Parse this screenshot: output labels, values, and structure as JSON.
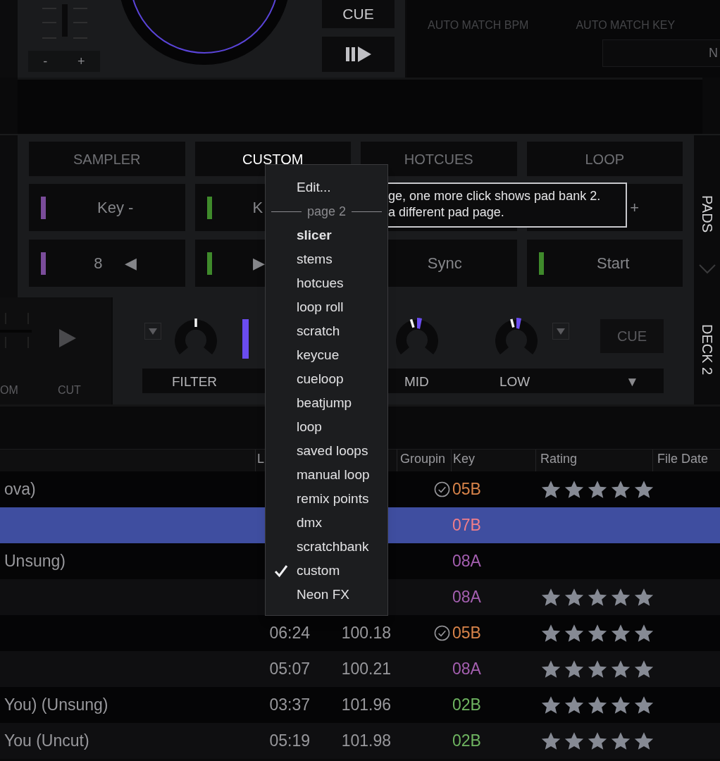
{
  "deck": {
    "minus": "-",
    "plus": "+",
    "cue": "CUE"
  },
  "match": {
    "bpm_label": "AUTO MATCH BPM",
    "key_label": "AUTO MATCH KEY",
    "key_field": "N"
  },
  "pad_tabs": [
    {
      "label": "SAMPLER",
      "selected": false
    },
    {
      "label": "CUSTOM",
      "selected": true
    },
    {
      "label": "HOTCUES",
      "selected": false
    },
    {
      "label": "LOOP",
      "selected": false
    }
  ],
  "pads": [
    {
      "kind": "center",
      "label": "Key -",
      "color": "#7a4c9a"
    },
    {
      "kind": "start",
      "label": "K",
      "color": "#3f8a2b"
    },
    {
      "kind": "blank"
    },
    {
      "kind": "end",
      "label": "+"
    },
    {
      "kind": "center",
      "label": "8",
      "icon": "◀",
      "color": "#7a4c9a"
    },
    {
      "kind": "start",
      "label": "▶",
      "color": "#3f8a2b"
    },
    {
      "kind": "center",
      "label": "Sync"
    },
    {
      "kind": "center",
      "label": "Start",
      "color": "#3f8a2b"
    }
  ],
  "pads_tab": "PADS",
  "left_strip": {
    "label_1": "OM",
    "label_2": "CUT"
  },
  "fx": {
    "filter": "FILTER",
    "mid": "MID",
    "low": "LOW",
    "cue": "CUE",
    "menu_arrow": "▼"
  },
  "deck_tab": "DECK 2",
  "table": {
    "columns": [
      "L",
      "Groupin",
      "Key",
      "Rating",
      "File Date"
    ],
    "rows": [
      {
        "title": "ova)",
        "analyzed": true,
        "key": "05B",
        "color": "#d9844a",
        "stars": 5,
        "selected": false
      },
      {
        "analyzed": false,
        "key": "07B",
        "color": "#f07e8a",
        "selected": true
      },
      {
        "title": "Unsung)",
        "analyzed": false,
        "key": "08A",
        "color": "#a45fb0",
        "selected": false
      },
      {
        "analyzed": false,
        "key": "08A",
        "color": "#a45fb0",
        "stars": 5,
        "selected": false
      },
      {
        "length": "06:24",
        "bpm": "100.18",
        "analyzed": true,
        "key": "05B",
        "color": "#d9844a",
        "stars": 5,
        "selected": false
      },
      {
        "length": "05:07",
        "bpm": "100.21",
        "analyzed": false,
        "key": "08A",
        "color": "#a45fb0",
        "stars": 5,
        "selected": false
      },
      {
        "title": "You) (Unsung)",
        "length": "03:37",
        "bpm": "101.96",
        "analyzed": false,
        "key": "02B",
        "color": "#6fb561",
        "stars": 5,
        "selected": false
      },
      {
        "title": "You (Uncut)",
        "length": "05:19",
        "bpm": "101.98",
        "analyzed": false,
        "key": "02B",
        "color": "#6fb561",
        "stars": 5,
        "selected": false
      }
    ]
  },
  "tooltip": {
    "lines": [
      "ge, one more click shows pad bank 2.",
      "a different pad page."
    ]
  },
  "menu": {
    "items": [
      {
        "kind": "item",
        "label": "Edit...",
        "checked": false
      },
      {
        "kind": "separator",
        "label": "page 2"
      },
      {
        "kind": "item",
        "label": "slicer",
        "bold": true,
        "checked": false
      },
      {
        "kind": "item",
        "label": "stems",
        "checked": false
      },
      {
        "kind": "item",
        "label": "hotcues",
        "checked": false
      },
      {
        "kind": "item",
        "label": "loop roll",
        "checked": false
      },
      {
        "kind": "item",
        "label": "scratch",
        "checked": false
      },
      {
        "kind": "item",
        "label": "keycue",
        "checked": false
      },
      {
        "kind": "item",
        "label": "cueloop",
        "checked": false
      },
      {
        "kind": "item",
        "label": "beatjump",
        "checked": false
      },
      {
        "kind": "item",
        "label": "loop",
        "checked": false
      },
      {
        "kind": "item",
        "label": "saved loops",
        "checked": false
      },
      {
        "kind": "item",
        "label": "manual loop",
        "checked": false
      },
      {
        "kind": "item",
        "label": "remix points",
        "checked": false
      },
      {
        "kind": "item",
        "label": "dmx",
        "checked": false
      },
      {
        "kind": "item",
        "label": "scratchbank",
        "checked": false
      },
      {
        "kind": "item",
        "label": "custom",
        "checked": true
      },
      {
        "kind": "item",
        "label": "Neon FX",
        "checked": false
      }
    ]
  }
}
